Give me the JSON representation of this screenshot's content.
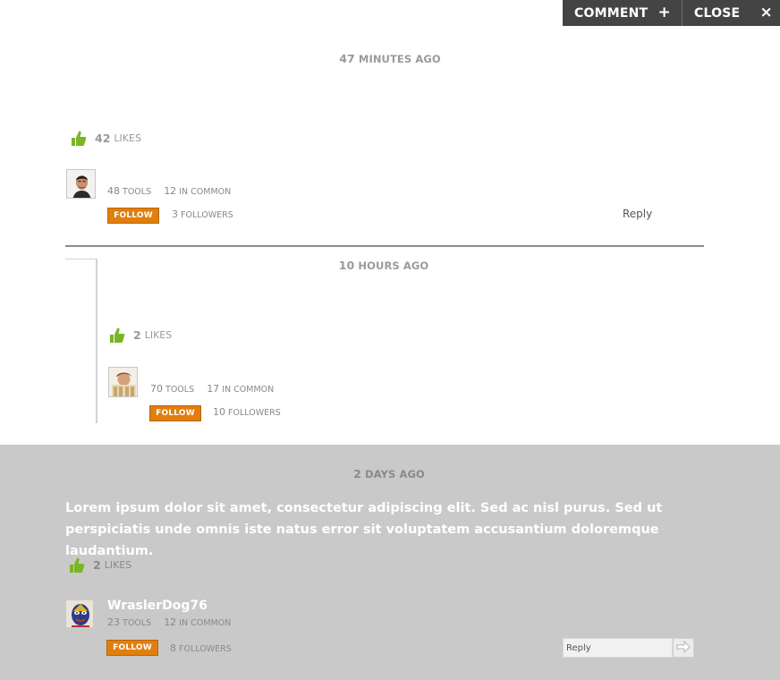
{
  "toolbar": {
    "comment_label": "COMMENT",
    "comment_glyph": "+",
    "close_label": "CLOSE",
    "close_glyph": "×"
  },
  "colors": {
    "toolbar_bg": "#444444",
    "follow_orange": "#e07e0e",
    "like_green": "#7ab526",
    "grey_section": "#c9c9c9"
  },
  "comments": [
    {
      "time_num": "47",
      "time_unit": "MINUTES AGO",
      "likes_count": "42",
      "likes_label": "LIKES",
      "avatar": "man-portrait",
      "tools_count": "48",
      "tools_label": "TOOLS",
      "common_count": "12",
      "common_label": "IN COMMON",
      "follow_label": "FOLLOW",
      "followers_count": "3",
      "followers_label": "FOLLOWERS",
      "reply_label": "Reply"
    },
    {
      "time_num": "10",
      "time_unit": "HOURS AGO",
      "likes_count": "2",
      "likes_label": "LIKES",
      "avatar": "person-with-books",
      "tools_count": "70",
      "tools_label": "TOOLS",
      "common_count": "17",
      "common_label": "IN COMMON",
      "follow_label": "FOLLOW",
      "followers_count": "10",
      "followers_label": "FOLLOWERS"
    },
    {
      "time_num": "2",
      "time_unit": "DAYS AGO",
      "body": "Lorem ipsum dolor sit amet, consectetur adipiscing elit. Sed ac nisl purus. Sed ut perspiciatis unde omnis iste natus error sit voluptatem accusantium doloremque laudantium.",
      "likes_count": "2",
      "likes_label": "LIKES",
      "avatar": "luchador-mask",
      "username": "WraslerDog76",
      "tools_count": "23",
      "tools_label": "TOOLS",
      "common_count": "12",
      "common_label": "IN COMMON",
      "follow_label": "FOLLOW",
      "followers_count": "8",
      "followers_label": "FOLLOWERS",
      "reply_placeholder": "Reply"
    }
  ]
}
